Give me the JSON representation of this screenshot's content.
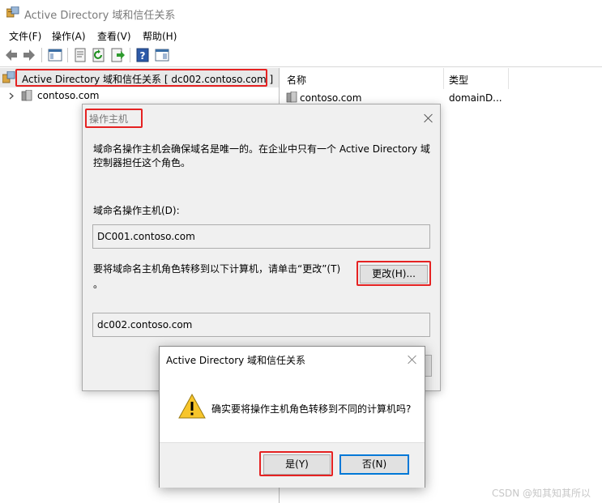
{
  "window": {
    "title": "Active Directory 域和信任关系"
  },
  "menu": {
    "items": [
      "文件(F)",
      "操作(A)",
      "查看(V)",
      "帮助(H)"
    ]
  },
  "toolbar": {
    "icons": [
      "back-arrow-icon",
      "forward-arrow-icon",
      "console-tree-icon",
      "properties-icon",
      "refresh-icon",
      "export-icon",
      "help-icon",
      "show-hide-icon"
    ]
  },
  "tree": {
    "root_label": "Active Directory 域和信任关系 [ dc002.contoso.com ]",
    "child_label": "contoso.com"
  },
  "list": {
    "columns": [
      "名称",
      "类型"
    ],
    "rows": [
      {
        "name": "contoso.com",
        "type": "domainD..."
      }
    ]
  },
  "dialog_master": {
    "title": "操作主机",
    "description": "域命名操作主机会确保域名是唯一的。在企业中只有一个 Active Directory 域控制器担任这个角色。",
    "current_label": "域命名操作主机(D):",
    "current_value": "DC001.contoso.com",
    "transfer_text": "要将域命名主机角色转移到以下计算机，请单击“更改”(T)",
    "transfer_text_cont": "。",
    "change_button": "更改(H)...",
    "target_value": "dc002.contoso.com"
  },
  "dialog_confirm": {
    "title": "Active Directory 域和信任关系",
    "message": "确实要将操作主机角色转移到不同的计算机吗?",
    "yes_button": "是(Y)",
    "no_button": "否(N)"
  },
  "watermark": "CSDN @知其知其所以",
  "colors": {
    "highlight": "#e52222",
    "dialog_bg": "#f0f0f0",
    "default_button_border": "#0078d7"
  }
}
